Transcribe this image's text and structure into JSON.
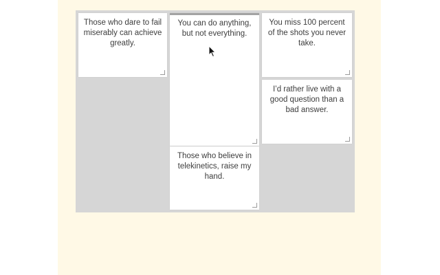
{
  "cards": [
    {
      "id": "card-1",
      "text": "Those who dare to fail miserably can achieve greatly."
    },
    {
      "id": "card-2",
      "text": "You can do anything, but not everything."
    },
    {
      "id": "card-3",
      "text": "You miss 100 percent of the shots you never take."
    },
    {
      "id": "card-4",
      "text": "I’d rather live with a good question than a bad answer."
    },
    {
      "id": "card-5",
      "text": "Those who believe in telekinetics, raise my hand."
    }
  ],
  "icons": {
    "resize_handle": "resize-corner-icon",
    "cursor": "mouse-pointer-icon"
  },
  "colors": {
    "page_background": "#fff9e6",
    "board_background": "#d6d6d6",
    "card_background": "#ffffff",
    "text": "#3d3d3d",
    "active_card_border": "#a3a3a3"
  }
}
